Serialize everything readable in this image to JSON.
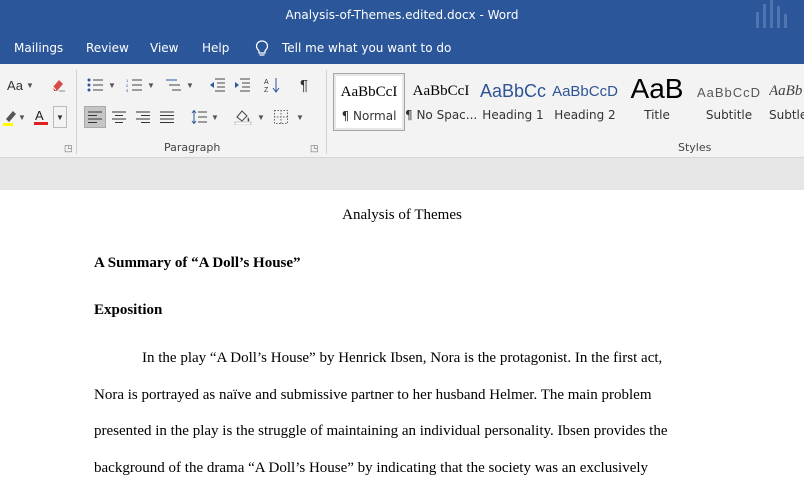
{
  "window": {
    "title": "Analysis-of-Themes.edited.docx - Word"
  },
  "menu": {
    "tabs": [
      "Mailings",
      "Review",
      "View",
      "Help"
    ],
    "tell_me": "Tell me what you want to do"
  },
  "ribbon": {
    "font_group": {
      "change_case_label": "Aa"
    },
    "paragraph_group": {
      "label": "Paragraph"
    },
    "styles_group": {
      "label": "Styles",
      "styles": [
        {
          "preview": "AaBbCcI",
          "name": "¶ Normal",
          "selected": true
        },
        {
          "preview": "AaBbCcI",
          "name": "¶ No Spac..."
        },
        {
          "preview": "AaBbCc",
          "name": "Heading 1"
        },
        {
          "preview": "AaBbCcD",
          "name": "Heading 2"
        },
        {
          "preview": "AaB",
          "name": "Title"
        },
        {
          "preview": "AaBbCcD",
          "name": "Subtitle"
        },
        {
          "preview": "AaBb",
          "name": "Subtle"
        }
      ]
    },
    "icons": [
      "highlight-icon",
      "font-color-icon",
      "bullets-icon",
      "numbering-icon",
      "multilevel-list-icon",
      "decrease-indent-icon",
      "increase-indent-icon",
      "sort-icon",
      "show-marks-icon",
      "align-left-icon",
      "center-icon",
      "align-right-icon",
      "justify-icon",
      "line-spacing-icon",
      "shading-icon",
      "borders-icon",
      "clear-formatting-icon"
    ]
  },
  "document": {
    "title": "Analysis of Themes",
    "heading1": "A Summary of “A Doll’s House”",
    "heading2": "Exposition",
    "lines": [
      "In the play “A Doll’s House” by Henrick Ibsen, Nora is the protagonist. In the first act,",
      "Nora is portrayed as naïve and submissive partner to her husband Helmer. The main problem",
      "presented in the play is the struggle of maintaining an individual personality. Ibsen provides the",
      "background of the drama “A Doll’s House” by indicating that the society was an exclusively"
    ]
  },
  "colors": {
    "brand": "#2b579a",
    "font_color_red": "#e02020",
    "highlight_yellow": "#ffff00"
  }
}
